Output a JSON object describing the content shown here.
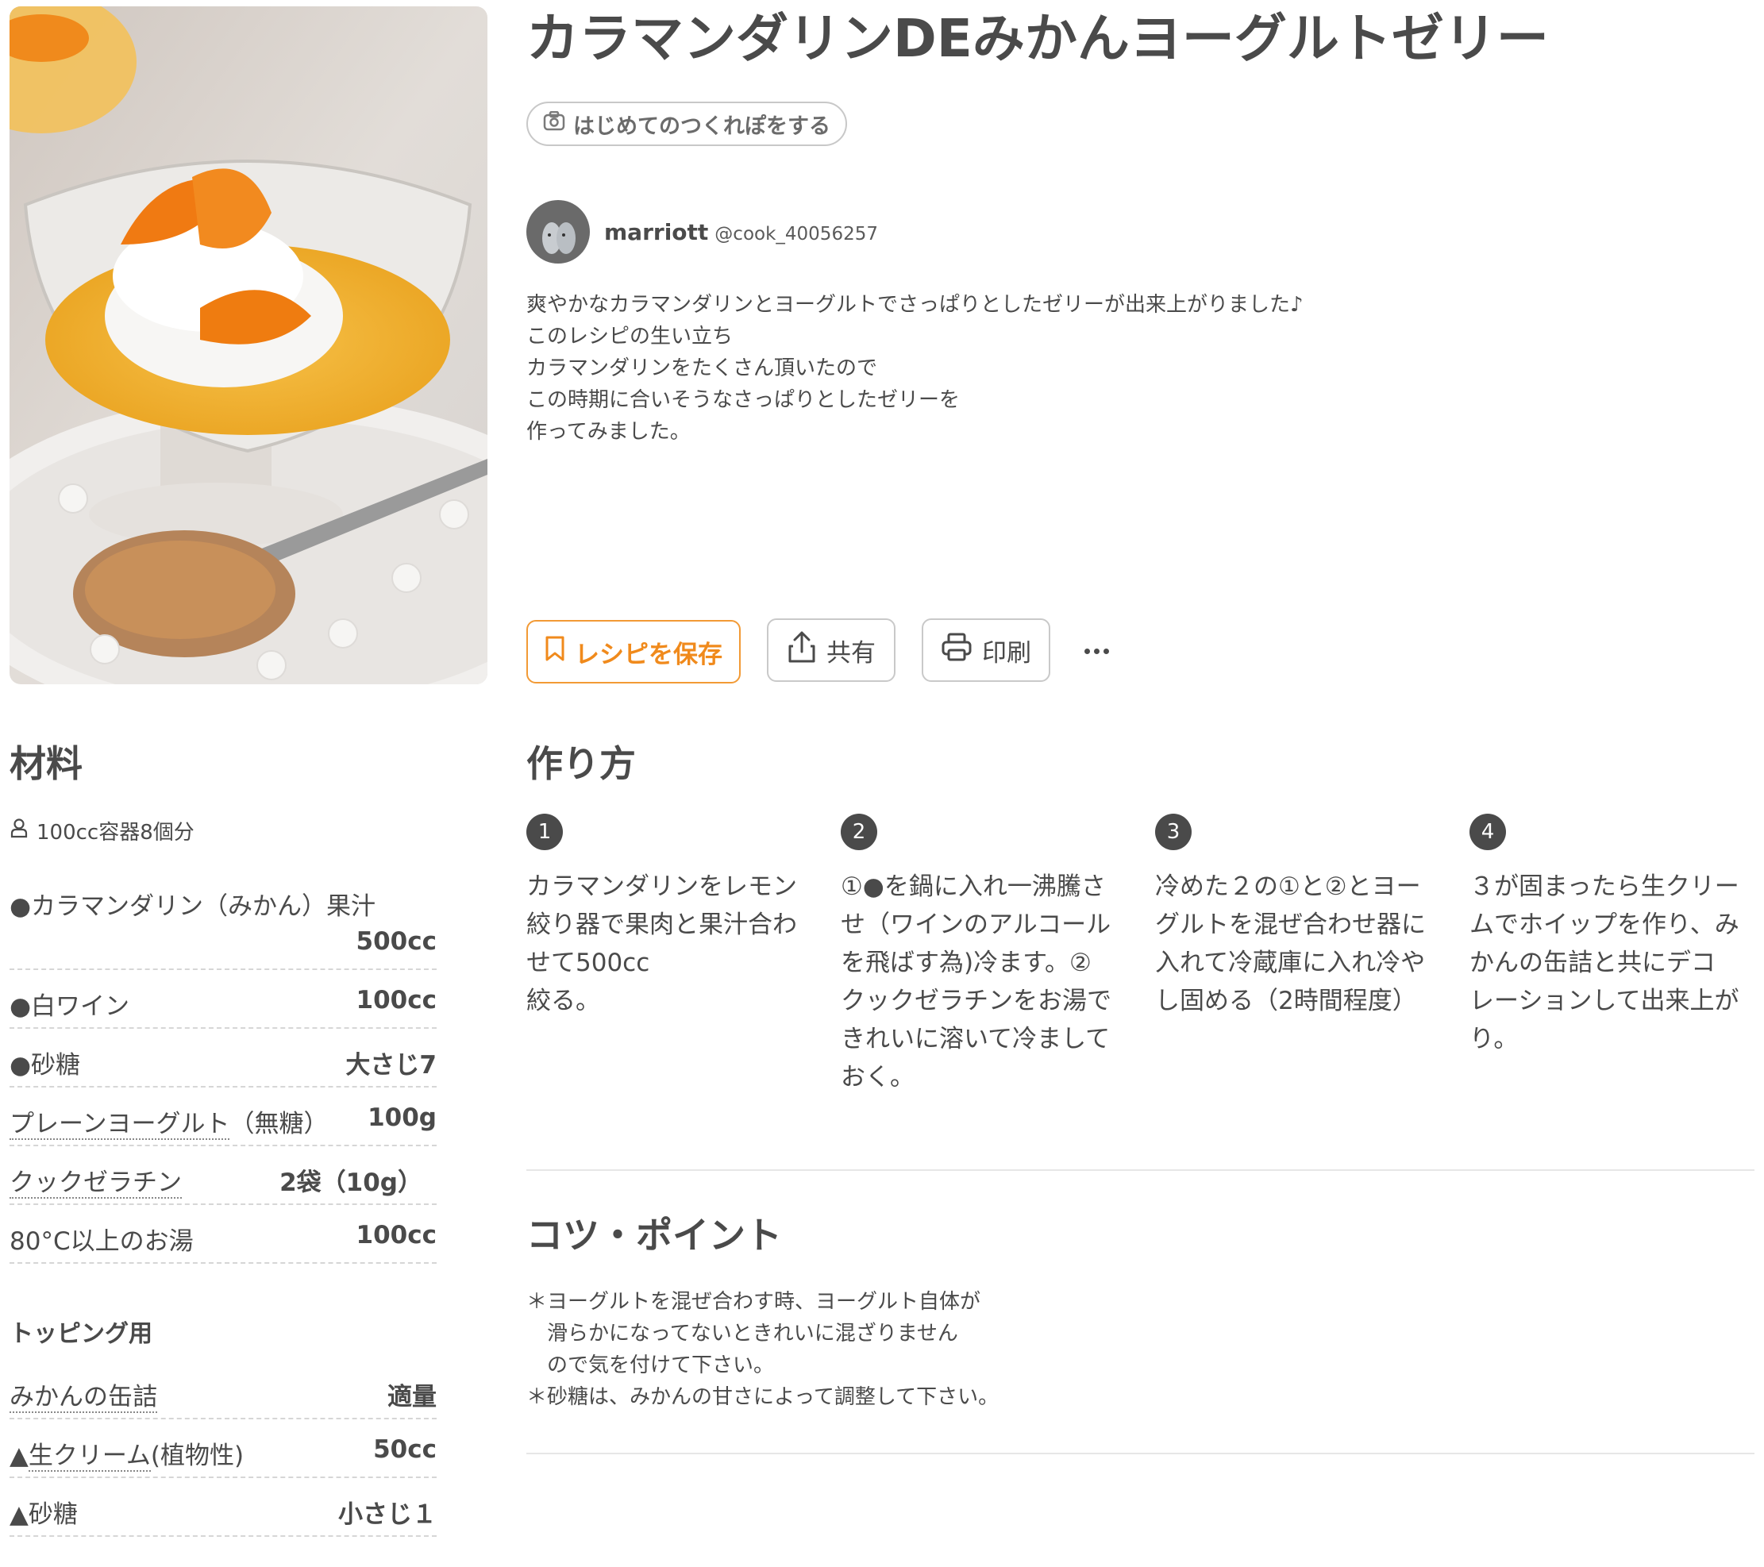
{
  "recipe": {
    "title": "カラマンダリンDEみかんヨーグルトゼリー",
    "tsukurepo_label": "はじめてのつくれぽをする",
    "author": {
      "name": "marriott",
      "handle": "@cook_40056257"
    },
    "description": [
      "爽やかなカラマンダリンとヨーグルトでさっぱりとしたゼリーが出来上がりました♪",
      "このレシピの生い立ち",
      "カラマンダリンをたくさん頂いたので",
      "この時期に合いそうなさっぱりとしたゼリーを",
      "作ってみました。"
    ]
  },
  "actions": {
    "save_label": "レシピを保存",
    "share_label": "共有",
    "print_label": "印刷"
  },
  "ingredients": {
    "heading": "材料",
    "servings": "100cc容器8個分",
    "items": [
      {
        "name": "●カラマンダリン（みかん）果汁",
        "qty": "500cc"
      },
      {
        "name": "●白ワイン",
        "qty": "100cc"
      },
      {
        "name": "●砂糖",
        "qty": "大さじ7"
      },
      {
        "name_link": "プレーンヨーグルト",
        "name_rest": "（無糖）",
        "qty": "100g"
      },
      {
        "name_link": "クックゼラチン",
        "qty": "2袋（10g）"
      },
      {
        "name": "80°C以上のお湯",
        "qty": "100cc"
      }
    ],
    "topping_heading": "トッピング用",
    "topping_items": [
      {
        "name_link": "みかんの缶詰",
        "qty": "適量"
      },
      {
        "name_prefix": "▲",
        "name_link": "生クリーム",
        "name_rest": "(植物性)",
        "qty": "50cc"
      },
      {
        "name": "▲砂糖",
        "qty": "小さじ１"
      }
    ]
  },
  "steps": {
    "heading": "作り方",
    "items": [
      {
        "num": "1",
        "lines": [
          "カラマンダリンをレモン",
          "絞り器で果肉と果汁合わ",
          "せて500cc",
          "絞る。"
        ]
      },
      {
        "num": "2",
        "lines": [
          "①●を鍋に入れ一沸騰さ",
          "せ（ワインのアルコール",
          "を飛ばす為)冷ます。②",
          "クックゼラチンをお湯で",
          "きれいに溶いて冷まして",
          "おく。"
        ]
      },
      {
        "num": "3",
        "lines": [
          "冷めた２の①と②とヨー",
          "グルトを混ぜ合わせ器に",
          "入れて冷蔵庫に入れ冷や",
          "し固める（2時間程度）"
        ]
      },
      {
        "num": "4",
        "lines": [
          "３が固まったら生クリー",
          "ムでホイップを作り、み",
          "かんの缶詰と共にデコ",
          "レーションして出来上が",
          "り。"
        ]
      }
    ]
  },
  "tips": {
    "heading": "コツ・ポイント",
    "lines": [
      "＊ヨーグルトを混ぜ合わす時、ヨーグルト自体が",
      "　滑らかになってないときれいに混ざりません",
      "　ので気を付けて下さい。",
      "＊砂糖は、みかんの甘さによって調整して下さい。"
    ]
  },
  "colors": {
    "accent": "#f08a1c",
    "text": "#4a4a4a",
    "border": "#c9c9c9"
  }
}
